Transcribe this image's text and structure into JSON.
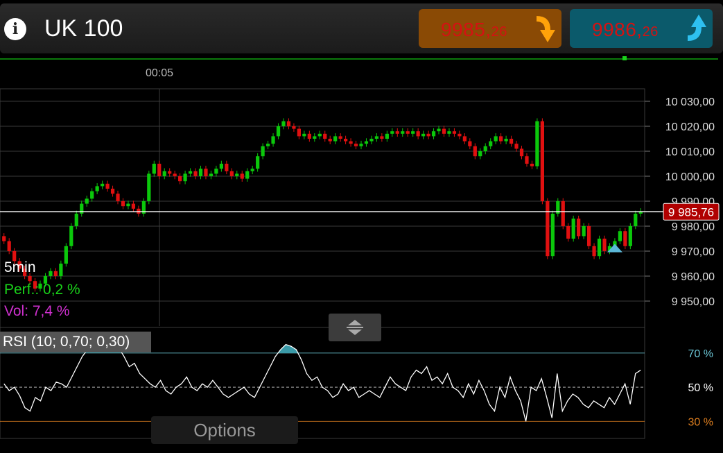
{
  "header": {
    "info_icon": "info-icon",
    "title": "UK 100",
    "sell": {
      "whole": "9985,",
      "decimals": "26",
      "arrow": "arrow-down-icon"
    },
    "buy": {
      "whole": "9986,",
      "decimals": "26",
      "arrow": "arrow-up-icon"
    }
  },
  "chart_data": [
    {
      "type": "candlestick",
      "interval": "5min",
      "perf_label": "Perf.: 0,2 %",
      "vol_label": "Vol: 7,4 %",
      "time_labels": [
        "00:05"
      ],
      "y_ticks": [
        "10 030,00",
        "10 020,00",
        "10 010,00",
        "10 000,00",
        "9 990,00",
        "9 980,00",
        "9 970,00",
        "9 960,00",
        "9 950,00"
      ],
      "ylim": [
        9940,
        10035
      ],
      "current_price": "9 985,76",
      "current_price_value": 9985.76,
      "colors": {
        "up": "#0bc80b",
        "down": "#e01010",
        "current_line": "#ffffff",
        "current_badge": "#b00000",
        "grid": "#3a3a3a"
      },
      "series_close": [
        9974,
        9970,
        9966,
        9963,
        9960,
        9958,
        9955,
        9957,
        9960,
        9962,
        9960,
        9965,
        9972,
        9980,
        9985,
        9989,
        9991,
        9994,
        9996,
        9997,
        9995,
        9993,
        9990,
        9988,
        9989,
        9987,
        9985,
        9990,
        10001,
        10005,
        10000,
        10002,
        10001,
        10000,
        9998,
        10001,
        10002,
        10000,
        10003,
        10000,
        10001,
        10003,
        10005,
        10002,
        10000,
        10001,
        9999,
        10002,
        10003,
        10008,
        10012,
        10013,
        10016,
        10020,
        10022,
        10020,
        10019,
        10016,
        10017,
        10015,
        10016,
        10017,
        10015,
        10014,
        10016,
        10015,
        10014,
        10013,
        10012,
        10013,
        10014,
        10015,
        10016,
        10015,
        10017,
        10018,
        10017,
        10018,
        10017,
        10018,
        10016,
        10017,
        10016,
        10018,
        10019,
        10017,
        10018,
        10017,
        10016,
        10014,
        10012,
        10008,
        10010,
        10012,
        10014,
        10016,
        10014,
        10015,
        10013,
        10011,
        10008,
        10005,
        10004,
        10022,
        9990,
        9968,
        9985,
        9990,
        9980,
        9975,
        9983,
        9976,
        9980,
        9972,
        9968,
        9975,
        9970,
        9972,
        9974,
        9978,
        9972,
        9980,
        9985,
        9986
      ],
      "marker": {
        "index": 118,
        "shape": "triangle-up",
        "color": "#5bb8d8"
      }
    },
    {
      "type": "line",
      "indicator": "RSI (10; 0,70; 0,30)",
      "levels": [
        {
          "label": "70 %",
          "value": 70,
          "color": "#6cc8d8"
        },
        {
          "label": "50 %",
          "value": 50,
          "color": "#ffffff"
        },
        {
          "label": "30 %",
          "value": 30,
          "color": "#e08020"
        }
      ],
      "ylim": [
        20,
        85
      ],
      "overbought_fill": "#3a9aa8",
      "values": [
        52,
        48,
        50,
        45,
        38,
        36,
        44,
        42,
        50,
        48,
        53,
        52,
        50,
        56,
        62,
        68,
        72,
        74,
        75,
        76,
        75,
        74,
        73,
        68,
        62,
        64,
        58,
        55,
        52,
        50,
        54,
        48,
        46,
        50,
        52,
        56,
        50,
        48,
        52,
        50,
        54,
        50,
        46,
        44,
        46,
        48,
        50,
        46,
        44,
        50,
        56,
        62,
        68,
        72,
        75,
        74,
        72,
        66,
        58,
        54,
        56,
        50,
        48,
        44,
        46,
        52,
        48,
        50,
        44,
        46,
        48,
        46,
        44,
        50,
        56,
        52,
        50,
        48,
        56,
        60,
        58,
        62,
        54,
        56,
        52,
        58,
        50,
        48,
        44,
        52,
        46,
        54,
        48,
        40,
        36,
        50,
        44,
        56,
        48,
        42,
        30,
        50,
        48,
        55,
        44,
        32,
        58,
        36,
        42,
        46,
        44,
        40,
        38,
        42,
        40,
        38,
        44,
        40,
        46,
        52,
        40,
        58,
        60
      ]
    }
  ],
  "rsi_panel": {
    "label": "RSI (10; 0,70; 0,30)"
  },
  "handle": {
    "icon": "resize-vertical-icon"
  },
  "options": {
    "label": "Options"
  }
}
